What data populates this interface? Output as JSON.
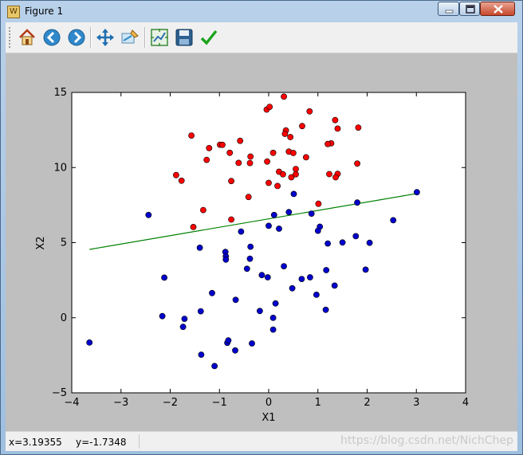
{
  "window": {
    "title": "Figure 1",
    "app_icon": "W"
  },
  "toolbar": {
    "buttons": [
      {
        "name": "home-button",
        "icon": "home-icon"
      },
      {
        "name": "back-button",
        "icon": "back-arrow-icon"
      },
      {
        "name": "forward-button",
        "icon": "forward-arrow-icon"
      },
      {
        "name": "pan-button",
        "icon": "move-icon"
      },
      {
        "name": "zoom-button",
        "icon": "zoom-rect-icon"
      },
      {
        "name": "subplots-button",
        "icon": "subplots-icon"
      },
      {
        "name": "save-button",
        "icon": "save-icon"
      },
      {
        "name": "edit-button",
        "icon": "checkmark-icon"
      }
    ]
  },
  "status": {
    "x_readout": "x=3.19355",
    "y_readout": "y=-1.7348",
    "watermark": "https://blog.csdn.net/NichChep"
  },
  "colors": {
    "class0": "#ff0000",
    "class1": "#0000cc",
    "line": "#008000",
    "canvas_bg": "#bfbfbf"
  },
  "chart_data": {
    "type": "scatter",
    "title": "",
    "xlabel": "X1",
    "ylabel": "X2",
    "xlim": [
      -4,
      4
    ],
    "ylim": [
      -5,
      15
    ],
    "xticks": [
      "−4",
      "−3",
      "−2",
      "−1",
      "0",
      "1",
      "2",
      "3",
      "4"
    ],
    "yticks": [
      "−5",
      "0",
      "5",
      "10",
      "15"
    ],
    "grid": false,
    "series": [
      {
        "color": "#ff0000",
        "points": [
          [
            0.31,
            14.72
          ],
          [
            -0.04,
            13.86
          ],
          [
            0.02,
            14.04
          ],
          [
            0.83,
            13.74
          ],
          [
            1.35,
            13.16
          ],
          [
            0.68,
            12.76
          ],
          [
            1.82,
            12.66
          ],
          [
            1.4,
            12.59
          ],
          [
            0.35,
            12.47
          ],
          [
            0.33,
            12.24
          ],
          [
            -1.57,
            12.13
          ],
          [
            0.44,
            12.03
          ],
          [
            -0.58,
            11.78
          ],
          [
            1.27,
            11.61
          ],
          [
            1.2,
            11.57
          ],
          [
            -0.99,
            11.52
          ],
          [
            -0.94,
            11.51
          ],
          [
            -1.21,
            11.29
          ],
          [
            0.41,
            11.06
          ],
          [
            0.5,
            10.97
          ],
          [
            0.09,
            10.98
          ],
          [
            -0.79,
            10.98
          ],
          [
            0.76,
            10.68
          ],
          [
            -0.37,
            10.73
          ],
          [
            -1.26,
            10.51
          ],
          [
            -0.03,
            10.4
          ],
          [
            -0.38,
            10.3
          ],
          [
            -0.61,
            10.31
          ],
          [
            1.8,
            10.26
          ],
          [
            0.55,
            9.9
          ],
          [
            0.21,
            9.72
          ],
          [
            0.29,
            9.55
          ],
          [
            0.55,
            9.55
          ],
          [
            1.4,
            9.58
          ],
          [
            1.23,
            9.56
          ],
          [
            0.46,
            9.35
          ],
          [
            1.36,
            9.35
          ],
          [
            -1.88,
            9.5
          ],
          [
            -1.77,
            9.12
          ],
          [
            -0.76,
            9.1
          ],
          [
            0.0,
            8.98
          ],
          [
            0.18,
            8.77
          ],
          [
            -0.41,
            8.04
          ],
          [
            1.01,
            7.59
          ],
          [
            -1.33,
            7.17
          ],
          [
            -0.76,
            6.54
          ],
          [
            -1.53,
            6.04
          ]
        ]
      },
      {
        "color": "#0000cc",
        "points": [
          [
            3.01,
            8.36
          ],
          [
            0.51,
            8.24
          ],
          [
            1.8,
            7.67
          ],
          [
            0.41,
            7.03
          ],
          [
            0.87,
            6.93
          ],
          [
            0.11,
            6.84
          ],
          [
            -2.44,
            6.84
          ],
          [
            2.53,
            6.49
          ],
          [
            0.0,
            6.12
          ],
          [
            1.04,
            6.06
          ],
          [
            0.21,
            5.93
          ],
          [
            1.0,
            5.79
          ],
          [
            -0.56,
            5.74
          ],
          [
            1.77,
            5.43
          ],
          [
            1.5,
            5.01
          ],
          [
            2.05,
            4.99
          ],
          [
            1.2,
            4.94
          ],
          [
            -0.37,
            4.73
          ],
          [
            -1.4,
            4.66
          ],
          [
            -0.88,
            4.38
          ],
          [
            -0.87,
            4.08
          ],
          [
            -0.87,
            3.87
          ],
          [
            -0.38,
            3.93
          ],
          [
            0.31,
            3.43
          ],
          [
            -0.44,
            3.26
          ],
          [
            1.17,
            3.17
          ],
          [
            1.97,
            3.2
          ],
          [
            -0.14,
            2.84
          ],
          [
            -0.02,
            2.69
          ],
          [
            -2.12,
            2.67
          ],
          [
            0.84,
            2.69
          ],
          [
            0.67,
            2.58
          ],
          [
            1.34,
            2.14
          ],
          [
            0.48,
            1.96
          ],
          [
            -1.15,
            1.64
          ],
          [
            0.97,
            1.53
          ],
          [
            -0.67,
            1.19
          ],
          [
            0.14,
            0.95
          ],
          [
            1.16,
            0.53
          ],
          [
            -1.38,
            0.43
          ],
          [
            -0.18,
            0.45
          ],
          [
            -2.16,
            0.11
          ],
          [
            0.09,
            -0.01
          ],
          [
            -1.71,
            -0.07
          ],
          [
            -1.74,
            -0.61
          ],
          [
            0.09,
            -0.79
          ],
          [
            -3.64,
            -1.65
          ],
          [
            -0.84,
            -1.67
          ],
          [
            -0.34,
            -1.71
          ],
          [
            -0.82,
            -1.51
          ],
          [
            -0.68,
            -2.18
          ],
          [
            -1.37,
            -2.46
          ],
          [
            -1.1,
            -3.22
          ]
        ]
      }
    ],
    "lines": [
      {
        "color": "#008000",
        "points": [
          [
            -3.64,
            4.55
          ],
          [
            3.01,
            8.27
          ]
        ]
      }
    ]
  }
}
